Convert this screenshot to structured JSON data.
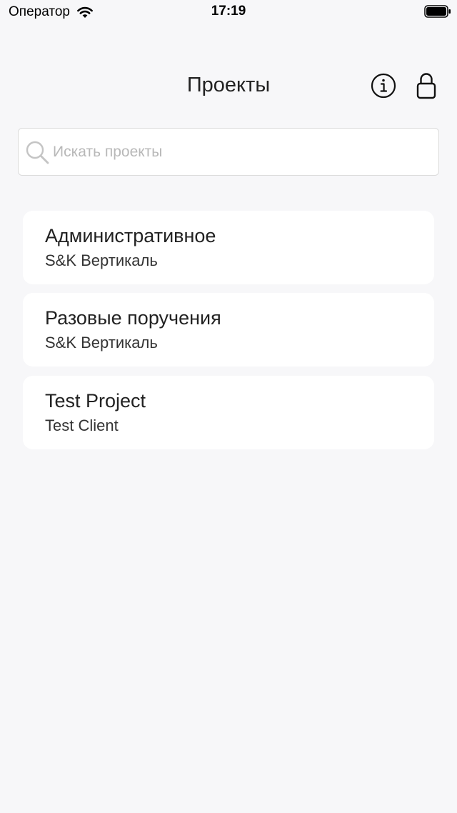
{
  "status_bar": {
    "carrier": "Оператор",
    "time": "17:19"
  },
  "header": {
    "title": "Проекты",
    "icons": [
      "info-icon",
      "lock-icon"
    ]
  },
  "search": {
    "placeholder": "Искать проекты",
    "value": ""
  },
  "projects": [
    {
      "title": "Административное",
      "client": "S&K Вертикаль"
    },
    {
      "title": "Разовые поручения",
      "client": "S&K Вертикаль"
    },
    {
      "title": "Test Project",
      "client": "Test Client"
    }
  ],
  "colors": {
    "background": "#f7f7f9",
    "card": "#ffffff",
    "text": "#222222",
    "placeholder": "#b8b8b8"
  }
}
